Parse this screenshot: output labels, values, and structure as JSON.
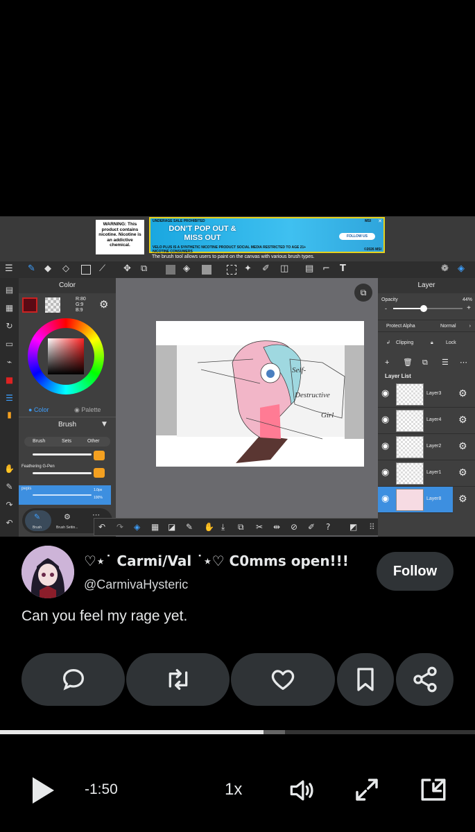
{
  "video": {
    "ad": {
      "warning": "WARNING: This product contains nicotine. Nicotine is an addictive chemical.",
      "top_left": "UNDERAGE SALE PROHIBITED",
      "top_right": "MSI",
      "headline": "DON'T POP OUT & MISS OUT",
      "follow": "FOLLOW US",
      "bottom": "VELO PLUS IS A SYNTHETIC NICOTINE PRODUCT SOCIAL MEDIA RESTRICTED TO AGE 21+ NICOTINE CONSUMERS",
      "copyright": "©2026 MSI",
      "close": "✕"
    },
    "caption": "The brush tool allows users to paint on the canvas with various brush types.",
    "color_panel": {
      "title": "Color",
      "r": "R:80",
      "g": "G:9",
      "b": "B:9",
      "tab_color": "Color",
      "tab_palette": "Palette"
    },
    "brush_panel": {
      "title": "Brush",
      "tabs": [
        "Brush",
        "Sets",
        "Other"
      ],
      "brushes": [
        {
          "name": ""
        },
        {
          "name": "Feathering G-Pen"
        },
        {
          "name": "pepis",
          "size": "1.0px",
          "opacity": "100%"
        }
      ],
      "bottom_tabs": [
        "Brush",
        "Brush Settin..."
      ]
    },
    "artwork": {
      "caption_lines": [
        "Self-",
        "Destructive",
        "Girl"
      ]
    },
    "layer_panel": {
      "title": "Layer",
      "opacity_label": "Opacity",
      "opacity_value": "44%",
      "opacity_level": 0.44,
      "protect_alpha": "Protect Alpha",
      "blend_mode": "Normal",
      "clipping": "Clipping",
      "lock": "Lock",
      "list_title": "Layer List",
      "layers": [
        {
          "name": "Layer3",
          "selected": false
        },
        {
          "name": "Layer4",
          "selected": false
        },
        {
          "name": "Layer2",
          "selected": false
        },
        {
          "name": "Layer1",
          "selected": false
        },
        {
          "name": "Layer8",
          "selected": true
        }
      ]
    }
  },
  "tweet": {
    "display_name": "♡⋆˙ Carmi/Val ˙⋆♡ C0mms open!!!",
    "handle": "@CarmivaHysteric",
    "follow_label": "Follow",
    "text": "Can you feel my rage yet.",
    "actions": [
      "reply-icon",
      "retweet-icon",
      "like-icon",
      "bookmark-icon",
      "share-icon"
    ]
  },
  "player": {
    "time_remaining": "-1:50",
    "speed": "1x",
    "progress": 0.555,
    "buffered": 0.6
  }
}
